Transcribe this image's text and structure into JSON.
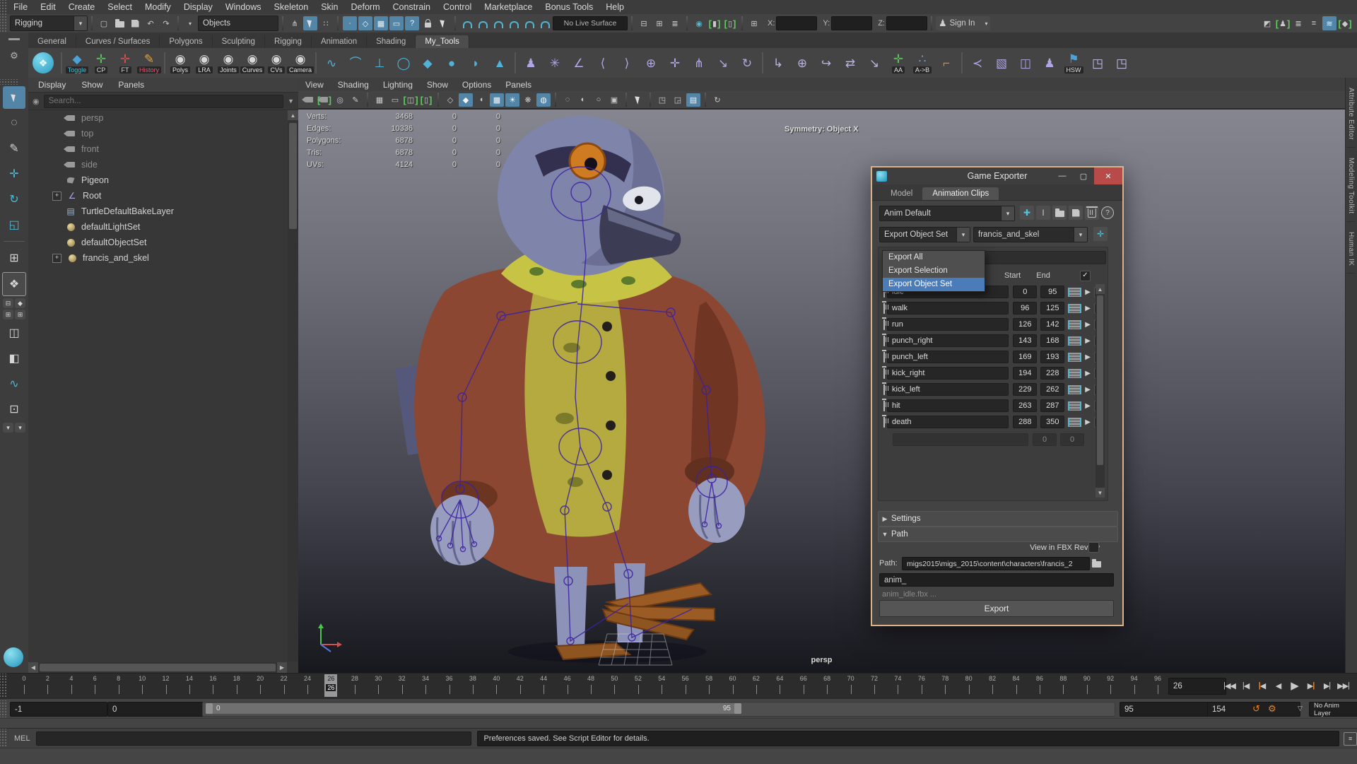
{
  "menubar": {
    "items": [
      "File",
      "Edit",
      "Create",
      "Select",
      "Modify",
      "Display",
      "Windows",
      "Skeleton",
      "Skin",
      "Deform",
      "Constrain",
      "Control",
      "Marketplace",
      "Bonus Tools",
      "Help"
    ]
  },
  "toolbar": {
    "menuset": "Rigging",
    "selection_filter": "Objects",
    "live_surface": "No Live Surface",
    "coord_labels": {
      "x": "X:",
      "y": "Y:",
      "z": "Z:"
    },
    "sign_in": "Sign In",
    "file_icons": [
      {
        "name": "new-scene-icon",
        "glyph": "▢"
      },
      {
        "name": "open-scene-icon",
        "kind": "folder"
      },
      {
        "name": "save-scene-icon",
        "kind": "save"
      },
      {
        "name": "undo-icon",
        "glyph": "↶"
      },
      {
        "name": "redo-icon",
        "glyph": "↷"
      }
    ],
    "mask_icons": [
      {
        "name": "select-hierarchy-icon",
        "glyph": "⋔"
      },
      {
        "name": "select-object-icon",
        "kind": "cursor",
        "active": true
      },
      {
        "name": "select-component-icon",
        "glyph": "∷"
      }
    ],
    "component_icons": [
      {
        "name": "point-mask-icon",
        "glyph": "∙",
        "active": true
      },
      {
        "name": "edge-mask-icon",
        "glyph": "◇",
        "active": true
      },
      {
        "name": "face-mask-icon",
        "glyph": "▦",
        "active": true
      },
      {
        "name": "hull-mask-icon",
        "glyph": "▭",
        "active": true
      },
      {
        "name": "misc-mask-icon",
        "glyph": "?",
        "active": true
      },
      {
        "name": "lock-selection-icon",
        "kind": "lock"
      },
      {
        "name": "highlight-selection-icon",
        "kind": "cursor"
      }
    ],
    "snap_icons": [
      {
        "name": "snap-grid-icon",
        "kind": "magnet"
      },
      {
        "name": "snap-curve-icon",
        "kind": "magnet"
      },
      {
        "name": "snap-point-icon",
        "kind": "magnet"
      },
      {
        "name": "snap-projected-center-icon",
        "kind": "magnet"
      },
      {
        "name": "snap-view-plane-icon",
        "kind": "magnet"
      },
      {
        "name": "make-live-icon",
        "kind": "magnet"
      }
    ],
    "history_icons": [
      {
        "name": "input-connections-icon",
        "glyph": "⊟"
      },
      {
        "name": "output-connections-icon",
        "glyph": "⊞"
      },
      {
        "name": "construction-history-icon",
        "glyph": "≣"
      }
    ],
    "render_icons": [
      {
        "name": "open-render-view-icon",
        "glyph": "◉",
        "teal": true
      },
      {
        "name": "render-current-frame-icon",
        "glyph": "▮",
        "bracket": true
      },
      {
        "name": "ipr-render-icon",
        "glyph": "▯",
        "bracket": true
      }
    ],
    "grid_icon": {
      "name": "xyz-gizmo-icon",
      "glyph": "⊞"
    },
    "window_icons": [
      {
        "name": "modeling-toolkit-icon",
        "glyph": "◩"
      },
      {
        "name": "character-controls-icon",
        "glyph": "♟",
        "bracket": true
      },
      {
        "name": "channel-box-icon",
        "glyph": "≣"
      },
      {
        "name": "attribute-editor-icon",
        "glyph": "≡"
      },
      {
        "name": "display-layers-icon",
        "glyph": "≋",
        "active": true
      },
      {
        "name": "tag-icon",
        "glyph": "◆",
        "bracket": true
      }
    ]
  },
  "shelf": {
    "tabs": [
      "General",
      "Curves / Surfaces",
      "Polygons",
      "Sculpting",
      "Rigging",
      "Animation",
      "Shading",
      "My_Tools"
    ],
    "active_tab": "My_Tools",
    "items": [
      {
        "kind": "logo",
        "name": "turtle-shelf-icon",
        "glyph": "❖"
      },
      {
        "kind": "sep"
      },
      {
        "kind": "chip",
        "name": "toggle-button",
        "label": "Toggle",
        "label_color": "#39c2d7",
        "glyph": "◆",
        "glyph_color": "#4aa3d8"
      },
      {
        "kind": "chip",
        "name": "cp-button",
        "label": "CP",
        "label_color": "#d8d8d8",
        "glyph": "✛",
        "glyph_color": "#5fc05f"
      },
      {
        "kind": "chip",
        "name": "ft-button",
        "label": "FT",
        "label_color": "#d8d8d8",
        "glyph": "✛",
        "glyph_color": "#d05050"
      },
      {
        "kind": "chip",
        "name": "history-button",
        "label": "History",
        "label_color": "#e05b74",
        "glyph": "✎",
        "glyph_color": "#e8a33d"
      },
      {
        "kind": "sep"
      },
      {
        "kind": "chip",
        "name": "polys-visibility-button",
        "label": "Polys",
        "label_color": "#e0e0e0",
        "glyph": "◉",
        "glyph_color": "#d8d8d8"
      },
      {
        "kind": "chip",
        "name": "lra-visibility-button",
        "label": "LRA",
        "label_color": "#e0e0e0",
        "glyph": "◉",
        "glyph_color": "#d8d8d8"
      },
      {
        "kind": "chip",
        "name": "joints-visibility-button",
        "label": "Joints",
        "label_color": "#e0e0e0",
        "glyph": "◉",
        "glyph_color": "#d8d8d8"
      },
      {
        "kind": "chip",
        "name": "curves-visibility-button",
        "label": "Curves",
        "label_color": "#e0e0e0",
        "glyph": "◉",
        "glyph_color": "#d8d8d8"
      },
      {
        "kind": "chip",
        "name": "cvs-visibility-button",
        "label": "CVs",
        "label_color": "#e0e0e0",
        "glyph": "◉",
        "glyph_color": "#d8d8d8"
      },
      {
        "kind": "chip",
        "name": "camera-visibility-button",
        "label": "Camera",
        "label_color": "#e0e0e0",
        "glyph": "◉",
        "glyph_color": "#d8d8d8"
      },
      {
        "kind": "sep"
      },
      {
        "kind": "icon",
        "name": "ep-curve-tool-icon",
        "glyph": "∿",
        "color": "#4fb3d9"
      },
      {
        "kind": "icon",
        "name": "arc-tool-icon",
        "glyph": "⌒",
        "color": "#4fb3d9"
      },
      {
        "kind": "icon",
        "name": "pin-tool-icon",
        "glyph": "⊥",
        "color": "#4fb3d9"
      },
      {
        "kind": "icon",
        "name": "circle-tool-icon",
        "glyph": "◯",
        "color": "#4fb3d9"
      },
      {
        "kind": "icon",
        "name": "cube-tool-icon",
        "glyph": "◆",
        "color": "#4fb3d9"
      },
      {
        "kind": "icon",
        "name": "sphere-tool-icon",
        "glyph": "●",
        "color": "#4fb3d9"
      },
      {
        "kind": "icon",
        "name": "half-sphere-tool-icon",
        "glyph": "◗",
        "color": "#4fb3d9"
      },
      {
        "kind": "icon",
        "name": "cone-tool-icon",
        "glyph": "▲",
        "color": "#4fb3d9"
      },
      {
        "kind": "sep"
      },
      {
        "kind": "icon",
        "name": "character-icon",
        "glyph": "♟",
        "color": "#b0a6e4"
      },
      {
        "kind": "icon",
        "name": "joint-tool-icon",
        "glyph": "✳",
        "color": "#b0a6e4"
      },
      {
        "kind": "icon",
        "name": "ik-handle-icon",
        "glyph": "∠",
        "color": "#b0a6e4"
      },
      {
        "kind": "icon",
        "name": "ik-spline-icon",
        "glyph": "⟨",
        "color": "#b0a6e4"
      },
      {
        "kind": "icon",
        "name": "insert-joint-icon",
        "glyph": "⟩",
        "color": "#b0a6e4"
      },
      {
        "kind": "icon",
        "name": "orient-joint-icon",
        "glyph": "⊕",
        "color": "#b0a6e4"
      },
      {
        "kind": "icon",
        "name": "add-influence-icon",
        "glyph": "✛",
        "color": "#b0a6e4"
      },
      {
        "kind": "icon",
        "name": "mirror-joint-icon",
        "glyph": "⋔",
        "color": "#b0a6e4"
      },
      {
        "kind": "icon",
        "name": "remove-joint-icon",
        "glyph": "↘",
        "color": "#b0a6e4"
      },
      {
        "kind": "icon",
        "name": "rotate-helper-icon",
        "glyph": "↻",
        "color": "#b0a6e4"
      },
      {
        "kind": "sep"
      },
      {
        "kind": "icon",
        "name": "parent-constraint-icon",
        "glyph": "↳",
        "color": "#b9b2dd"
      },
      {
        "kind": "icon",
        "name": "aim-constraint-icon",
        "glyph": "⊕",
        "color": "#b9b2dd"
      },
      {
        "kind": "icon",
        "name": "orient-constraint-icon",
        "glyph": "↪",
        "color": "#b9b2dd"
      },
      {
        "kind": "icon",
        "name": "point-constraint-icon",
        "glyph": "⇄",
        "color": "#b9b2dd"
      },
      {
        "kind": "icon",
        "name": "scale-constraint-icon",
        "glyph": "↘",
        "color": "#b9b2dd"
      },
      {
        "kind": "chip",
        "name": "aa-button",
        "label": "AA",
        "label_color": "#e0e0e0",
        "glyph": "✛",
        "glyph_color": "#5fc05f"
      },
      {
        "kind": "chip",
        "name": "a-to-b-button",
        "label": "A->B",
        "label_color": "#e0e0e0",
        "glyph": "∴",
        "glyph_color": "#6fa8d8"
      },
      {
        "kind": "icon",
        "name": "bone-link-icon",
        "glyph": "⌐",
        "color": "#e8832a"
      },
      {
        "kind": "sep"
      },
      {
        "kind": "icon",
        "name": "bend-deformer-icon",
        "glyph": "≺",
        "color": "#b0a6e4"
      },
      {
        "kind": "icon",
        "name": "paint-skin-weights-icon",
        "glyph": "▧",
        "color": "#b0a6e4"
      },
      {
        "kind": "icon",
        "name": "mirror-skin-weights-icon",
        "glyph": "◫",
        "color": "#b0a6e4"
      },
      {
        "kind": "icon",
        "name": "bind-skin-icon",
        "glyph": "♟",
        "color": "#b0a6e4"
      },
      {
        "kind": "chip",
        "name": "hsw-button",
        "label": "HSW",
        "label_color": "#e0e0e0",
        "glyph": "⚑",
        "glyph_color": "#4aa3d8"
      },
      {
        "kind": "icon",
        "name": "window-shelf-icon-1",
        "glyph": "◳",
        "color": "#c9bfe8"
      },
      {
        "kind": "icon",
        "name": "window-shelf-icon-2",
        "glyph": "◳",
        "color": "#c9bfe8"
      }
    ]
  },
  "toolbox": {
    "tools": [
      {
        "name": "select-tool",
        "kind": "cursor",
        "active": true
      },
      {
        "name": "lasso-select-tool",
        "glyph": "◌"
      },
      {
        "name": "paint-select-tool",
        "glyph": "✎"
      },
      {
        "name": "move-tool",
        "glyph": "✛",
        "color": "#53b6d1"
      },
      {
        "name": "rotate-tool",
        "glyph": "↻",
        "color": "#53b6d1"
      },
      {
        "name": "scale-tool",
        "glyph": "◱",
        "color": "#53b6d1"
      }
    ],
    "layouts": [
      {
        "name": "layout-four-pane-button",
        "glyph": "⊞"
      },
      {
        "name": "layout-single-pane-button",
        "glyph": "❖",
        "active": true
      },
      {
        "name": "layout-pair-1-button",
        "glyph": "⊟",
        "mini": true
      },
      {
        "name": "layout-pair-2-button",
        "glyph": "◆",
        "mini": true
      },
      {
        "name": "layout-pair-3-button",
        "glyph": "⊞",
        "mini": true
      },
      {
        "name": "layout-pair-4-button",
        "glyph": "⊞",
        "mini": true
      },
      {
        "name": "layout-outliner-persp-button",
        "glyph": "◫"
      },
      {
        "name": "layout-persp-button",
        "glyph": "◧"
      },
      {
        "name": "layout-graph-editor-button",
        "glyph": "∿",
        "color": "#53b6d1"
      },
      {
        "name": "layout-hypergraph-button",
        "glyph": "⊡"
      },
      {
        "name": "layout-dropdown-1",
        "glyph": "▾",
        "mini": true
      },
      {
        "name": "layout-dropdown-2",
        "glyph": "▾",
        "mini": true
      }
    ]
  },
  "outliner": {
    "menus": [
      "Display",
      "Show",
      "Panels"
    ],
    "search_placeholder": "Search...",
    "items": [
      {
        "label": "persp",
        "icon": "camera",
        "muted": true
      },
      {
        "label": "top",
        "icon": "camera",
        "muted": true
      },
      {
        "label": "front",
        "icon": "camera",
        "muted": true
      },
      {
        "label": "side",
        "icon": "camera",
        "muted": true
      },
      {
        "label": "Pigeon",
        "icon": "mesh"
      },
      {
        "label": "Root",
        "icon": "joint",
        "expandable": true
      },
      {
        "label": "TurtleDefaultBakeLayer",
        "icon": "layer"
      },
      {
        "label": "defaultLightSet",
        "icon": "set"
      },
      {
        "label": "defaultObjectSet",
        "icon": "set"
      },
      {
        "label": "francis_and_skel",
        "icon": "set",
        "expandable": true
      }
    ]
  },
  "viewport": {
    "menus": [
      "View",
      "Shading",
      "Lighting",
      "Show",
      "Options",
      "Panels"
    ],
    "icons": [
      {
        "name": "camera-icon",
        "kind": "camera"
      },
      {
        "name": "camera-lock-icon",
        "kind": "camera",
        "bracket": true
      },
      {
        "name": "camera-attributes-icon",
        "glyph": "◎"
      },
      {
        "name": "bookmark-icon",
        "glyph": "✎"
      },
      {
        "sep": true
      },
      {
        "name": "grid-toggle-icon",
        "glyph": "▦"
      },
      {
        "name": "film-gate-icon",
        "glyph": "▭"
      },
      {
        "name": "resolution-gate-icon",
        "glyph": "◫",
        "bracket": true
      },
      {
        "name": "gate-mask-icon",
        "glyph": "▯",
        "bracket": true
      },
      {
        "sep": true
      },
      {
        "name": "wireframe-icon",
        "glyph": "◇"
      },
      {
        "name": "shaded-icon",
        "glyph": "◆",
        "active": true
      },
      {
        "name": "wireframe-on-shaded-icon",
        "glyph": "◖"
      },
      {
        "name": "textured-icon",
        "glyph": "▩",
        "active": true
      },
      {
        "name": "use-all-lights-icon",
        "glyph": "☀",
        "active": true
      },
      {
        "name": "shadows-icon",
        "glyph": "❋"
      },
      {
        "name": "ambient-occlusion-icon",
        "glyph": "◍",
        "active": true
      },
      {
        "sep": true
      },
      {
        "name": "isolate-select-icon",
        "glyph": "◌"
      },
      {
        "name": "xray-icon",
        "glyph": "◐"
      },
      {
        "name": "xray-joints-icon",
        "glyph": "○"
      },
      {
        "name": "exposure-icon",
        "glyph": "▣"
      },
      {
        "sep": true
      },
      {
        "name": "select-context-icon",
        "kind": "cursor"
      },
      {
        "sep": true
      },
      {
        "name": "copy-view-icon",
        "glyph": "◳"
      },
      {
        "name": "paste-view-icon",
        "glyph": "◲"
      },
      {
        "name": "image-plane-icon",
        "glyph": "▤",
        "active": true
      },
      {
        "sep": true
      },
      {
        "name": "refresh-icon",
        "glyph": "↻"
      }
    ],
    "hud": [
      [
        "Verts:",
        "3468",
        "0",
        "0"
      ],
      [
        "Edges:",
        "10336",
        "0",
        "0"
      ],
      [
        "Polygons:",
        "6878",
        "0",
        "0"
      ],
      [
        "Tris:",
        "6878",
        "0",
        "0"
      ],
      [
        "UVs:",
        "4124",
        "0",
        "0"
      ]
    ],
    "symmetry": "Symmetry: Object X",
    "camera_label": "persp"
  },
  "right_tabs": [
    "Attribute Editor",
    "Modeling Toolkit",
    "Human IK"
  ],
  "game_exporter": {
    "title": "Game Exporter",
    "tabs": [
      "Model",
      "Animation Clips"
    ],
    "active_tab": "Animation Clips",
    "preset": "Anim Default",
    "preset_icons": [
      {
        "name": "new-preset-icon",
        "glyph": "✚",
        "color": "#4fc3e0"
      },
      {
        "name": "rename-preset-icon",
        "glyph": "I"
      },
      {
        "name": "load-preset-icon",
        "kind": "folder"
      },
      {
        "name": "save-preset-icon",
        "kind": "save"
      },
      {
        "name": "delete-preset-icon",
        "kind": "trash"
      },
      {
        "name": "help-icon",
        "glyph": "?",
        "round": true
      }
    ],
    "export_mode": "Export Object Set",
    "object_set": "francis_and_skel",
    "dropdown": {
      "options": [
        "Export All",
        "Export Selection",
        "Export Object Set"
      ],
      "selected_index": 2
    },
    "columns": {
      "start": "Start",
      "end": "End"
    },
    "clips": [
      {
        "name": "idle",
        "start": "0",
        "end": "95",
        "enabled": true
      },
      {
        "name": "walk",
        "start": "96",
        "end": "125",
        "enabled": true
      },
      {
        "name": "run",
        "start": "126",
        "end": "142",
        "enabled": true
      },
      {
        "name": "punch_right",
        "start": "143",
        "end": "168",
        "enabled": true
      },
      {
        "name": "punch_left",
        "start": "169",
        "end": "193",
        "enabled": true
      },
      {
        "name": "kick_right",
        "start": "194",
        "end": "228",
        "enabled": true
      },
      {
        "name": "kick_left",
        "start": "229",
        "end": "262",
        "enabled": true
      },
      {
        "name": "hit",
        "start": "263",
        "end": "287",
        "enabled": true
      },
      {
        "name": "death",
        "start": "288",
        "end": "350",
        "enabled": true
      }
    ],
    "new_row": {
      "start": "0",
      "end": "0",
      "add_label": "+"
    },
    "sections": {
      "settings": "Settings",
      "path": "Path"
    },
    "fbx_review": "View in FBX Review",
    "path_label": "Path:",
    "path_value": "migs2015\\migs_2015\\content\\characters\\francis_2",
    "filename_prefix": "anim_",
    "filename_preview": "anim_idle.fbx ...",
    "export_button": "Export"
  },
  "timeline": {
    "start": 0,
    "end": 96,
    "step": 2,
    "current": 26,
    "current_field": "26"
  },
  "playback": [
    "go-to-start-button",
    "step-back-button",
    "previous-key-button",
    "play-backwards-button",
    "play-forwards-button",
    "next-key-button",
    "step-forward-button",
    "go-to-end-button"
  ],
  "range_slider": {
    "anim_start": "-1",
    "play_start": "0",
    "bar_start_label": "0",
    "bar_end_label": "95",
    "play_end": "95",
    "anim_end": "154",
    "anim_layer": "No Anim Layer"
  },
  "command_line": {
    "label": "MEL",
    "message": "Preferences saved. See Script Editor for details."
  }
}
